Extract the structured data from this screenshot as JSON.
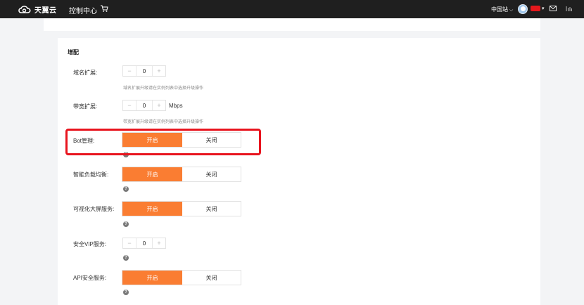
{
  "header": {
    "brand": "天翼云",
    "console_label": "控制中心",
    "region_label": "中国站",
    "colors": {
      "bar": "#1f1f1f",
      "accent": "#fa7d32",
      "highlight": "#e8141e"
    }
  },
  "section": {
    "title": "增配"
  },
  "fields": {
    "domain_ext": {
      "label": "域名扩展:",
      "value": "0",
      "hint": "域名扩展升级请在实例列表中选择升级操作"
    },
    "bandwidth_ext": {
      "label": "带宽扩展:",
      "value": "0",
      "unit": "Mbps",
      "hint": "带宽扩展升级请在实例列表中选择升级操作"
    },
    "bot_mgmt": {
      "label": "Bot管理:",
      "on": "开启",
      "off": "关闭",
      "selected": "开启"
    },
    "smart_lb": {
      "label": "智能负载均衡:",
      "on": "开启",
      "off": "关闭",
      "selected": "开启"
    },
    "viz_screen": {
      "label": "可视化大屏服务:",
      "on": "开启",
      "off": "关闭",
      "selected": "开启"
    },
    "secure_vip": {
      "label": "安全VIP服务:",
      "value": "0"
    },
    "api_security": {
      "label": "API安全服务:",
      "on": "开启",
      "off": "关闭",
      "selected": "开启"
    }
  },
  "icons": {
    "minus": "−",
    "plus": "+",
    "help": "?",
    "chevron": "⌵"
  }
}
